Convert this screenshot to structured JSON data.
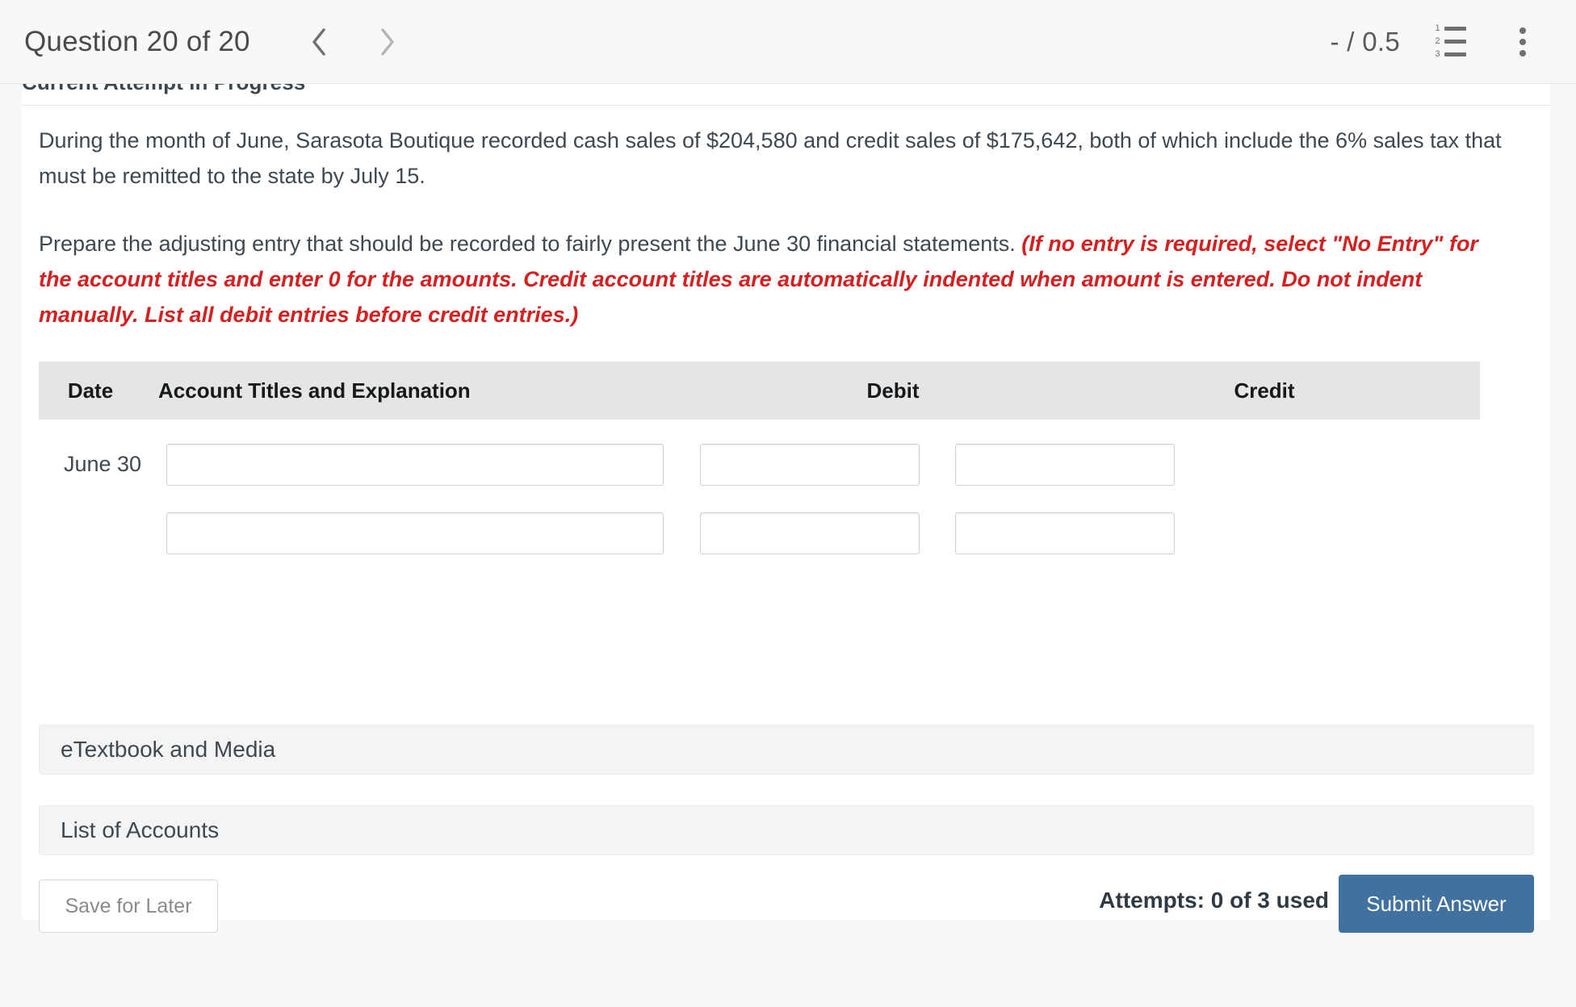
{
  "header": {
    "question_title": "Question 20 of 20",
    "prev_label": "chevron-left",
    "next_label": "chevron-right",
    "score": "- / 0.5",
    "list_icon": "numbered-list-icon",
    "list_numbers": [
      "1",
      "2",
      "3"
    ],
    "menu_icon": "kebab-menu-icon"
  },
  "attempt": {
    "heading": "Current Attempt in Progress"
  },
  "question": {
    "paragraph1": "During the month of June, Sarasota Boutique recorded cash sales of $204,580 and credit sales of $175,642, both of which include the 6% sales tax that must be remitted to the state by July 15.",
    "paragraph2_black": "Prepare the adjusting entry that should be recorded to fairly present the June 30 financial statements. ",
    "paragraph2_red": "(If no entry is required, select \"No Entry\" for the account titles and enter 0 for the amounts. Credit account titles are automatically indented when amount is entered. Do not indent manually. List all debit entries before credit entries.)"
  },
  "journal": {
    "headers": {
      "date": "Date",
      "account": "Account Titles and Explanation",
      "debit": "Debit",
      "credit": "Credit"
    },
    "rows": [
      {
        "date": "June 30",
        "account_value": "",
        "account_placeholder": "",
        "debit_value": "",
        "debit_placeholder": "",
        "credit_value": "",
        "credit_placeholder": ""
      },
      {
        "date": "",
        "account_value": "",
        "account_placeholder": "",
        "debit_value": "",
        "debit_placeholder": "",
        "credit_value": "",
        "credit_placeholder": ""
      }
    ]
  },
  "resources": {
    "etextbook_label": "eTextbook and Media",
    "accounts_label": "List of Accounts"
  },
  "footer": {
    "save_label": "Save for Later",
    "attempts_label": "Attempts: 0 of 3 used",
    "submit_label": "Submit Answer"
  },
  "colors": {
    "accent_blue": "#41729f",
    "instruction_red": "#d61f1f",
    "table_header_gray": "#e5e5e5",
    "bar_gray": "#f4f4f4",
    "page_background": "#f7f8f9"
  }
}
